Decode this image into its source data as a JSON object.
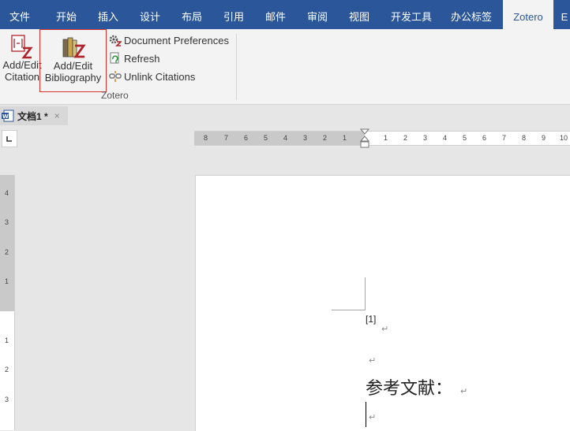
{
  "ribbon_tabs": [
    {
      "label": "文件"
    },
    {
      "label": "开始"
    },
    {
      "label": "插入"
    },
    {
      "label": "设计"
    },
    {
      "label": "布局"
    },
    {
      "label": "引用"
    },
    {
      "label": "邮件"
    },
    {
      "label": "审阅"
    },
    {
      "label": "视图"
    },
    {
      "label": "开发工具"
    },
    {
      "label": "办公标签"
    },
    {
      "label": "Zotero",
      "active": true
    },
    {
      "label": "E"
    }
  ],
  "zotero_group": {
    "add_edit_citation": [
      "Add/Edit",
      "Citation"
    ],
    "add_edit_bibliography": [
      "Add/Edit",
      "Bibliography"
    ],
    "document_preferences": "Document Preferences",
    "refresh": "Refresh",
    "unlink_citations": "Unlink Citations",
    "group_label": "Zotero"
  },
  "document_tab": {
    "name": "文档1 *",
    "close": "×"
  },
  "ruler": {
    "horizontal_left": [
      "8",
      "7",
      "6",
      "5",
      "4",
      "3",
      "2",
      "1"
    ],
    "horizontal_right": [
      "1",
      "2",
      "3",
      "4",
      "5",
      "6",
      "7",
      "8",
      "9",
      "10"
    ],
    "vertical": [
      "4",
      "3",
      "2",
      "1",
      "1",
      "2",
      "3"
    ]
  },
  "document": {
    "citation": "[1]",
    "heading": "参考文献：",
    "paragraph_mark": "↵"
  },
  "colors": {
    "ribbon_tab_bar": "#2b579a",
    "highlight_box": "#d9302a",
    "zotero_red": "#b0242c"
  }
}
